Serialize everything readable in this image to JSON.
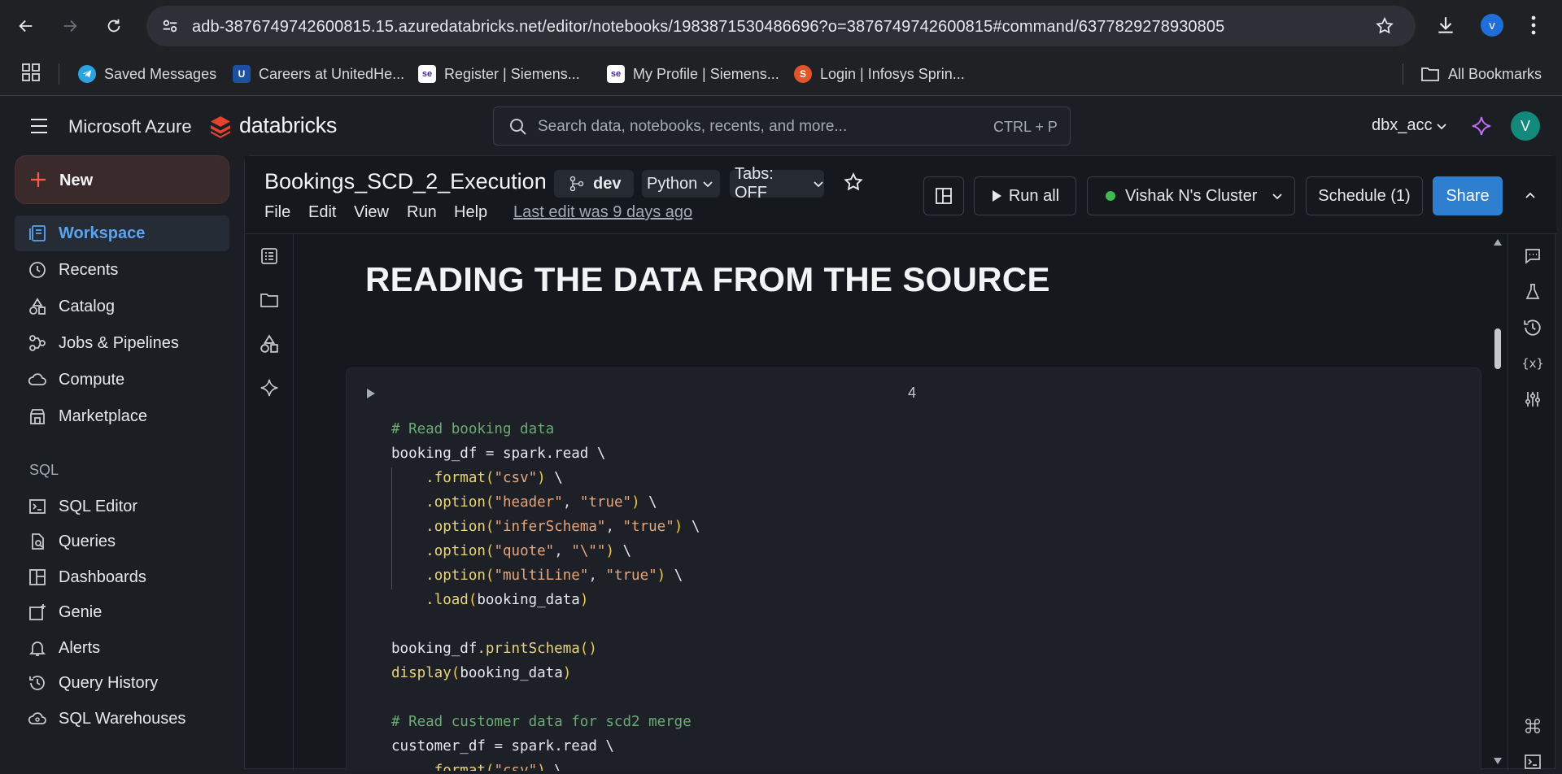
{
  "browser": {
    "url": "adb-3876749742600815.15.azuredatabricks.net/editor/notebooks/1983871530486696?o=3876749742600815#command/6377829278930805",
    "profile_initial": "v",
    "bookmarks": [
      {
        "label": "Saved Messages",
        "icon": "telegram-icon",
        "color": "#2aa3e0"
      },
      {
        "label": "Careers at UnitedHe...",
        "icon": "unitedhealth-icon",
        "color": "#1d4fa3"
      },
      {
        "label": "Register | Siemens...",
        "icon": "siemens-icon",
        "color": "#ffffff"
      },
      {
        "label": "My Profile | Siemens...",
        "icon": "siemens-icon",
        "color": "#ffffff"
      },
      {
        "label": "Login | Infosys Sprin...",
        "icon": "infosys-icon",
        "color": "#e2552a"
      }
    ],
    "all_bookmarks": "All Bookmarks"
  },
  "header": {
    "azure": "Microsoft Azure",
    "brand": "databricks",
    "search_placeholder": "Search data, notebooks, recents, and more...",
    "search_shortcut": "CTRL + P",
    "workspace": "dbx_acc",
    "avatar": "V"
  },
  "sidebar": {
    "new_label": "New",
    "items": [
      {
        "label": "Workspace",
        "icon": "workspace-icon",
        "active": true
      },
      {
        "label": "Recents",
        "icon": "clock-icon"
      },
      {
        "label": "Catalog",
        "icon": "catalog-icon"
      },
      {
        "label": "Jobs & Pipelines",
        "icon": "jobs-icon"
      },
      {
        "label": "Compute",
        "icon": "cloud-icon"
      },
      {
        "label": "Marketplace",
        "icon": "store-icon"
      }
    ],
    "sql_section": "SQL",
    "sql_items": [
      {
        "label": "SQL Editor",
        "icon": "sql-editor-icon"
      },
      {
        "label": "Queries",
        "icon": "queries-icon"
      },
      {
        "label": "Dashboards",
        "icon": "dashboards-icon"
      },
      {
        "label": "Genie",
        "icon": "genie-icon"
      },
      {
        "label": "Alerts",
        "icon": "bell-icon"
      },
      {
        "label": "Query History",
        "icon": "history-icon"
      },
      {
        "label": "SQL Warehouses",
        "icon": "warehouse-icon"
      }
    ]
  },
  "notebook": {
    "title": "Bookings_SCD_2_Execution",
    "branch": "dev",
    "language": "Python",
    "tabs": "Tabs: OFF",
    "menu": [
      "File",
      "Edit",
      "View",
      "Run",
      "Help"
    ],
    "last_edit": "Last edit was 9 days ago",
    "run_all": "Run all",
    "cluster": "Vishak N's Cluster",
    "cluster_status_color": "#3fb950",
    "schedule": "Schedule (1)",
    "share": "Share",
    "heading": "READING THE DATA FROM THE SOURCE",
    "cell_number": "4"
  },
  "code_lines": [
    [
      {
        "t": "# Read booking data",
        "c": "c-com"
      }
    ],
    [
      {
        "t": "booking_df",
        "c": "c-var"
      },
      {
        "t": " = ",
        "c": "c-op"
      },
      {
        "t": "spark.read",
        "c": "c-var"
      },
      {
        "t": " \\",
        "c": "c-bs"
      }
    ],
    [
      {
        "t": "    ",
        "c": "c-var"
      },
      {
        "t": ".format",
        "c": "c-fn"
      },
      {
        "t": "(",
        "c": "c-par"
      },
      {
        "t": "\"csv\"",
        "c": "c-str"
      },
      {
        "t": ")",
        "c": "c-par"
      },
      {
        "t": " \\",
        "c": "c-bs"
      }
    ],
    [
      {
        "t": "    ",
        "c": "c-var"
      },
      {
        "t": ".option",
        "c": "c-fn"
      },
      {
        "t": "(",
        "c": "c-par"
      },
      {
        "t": "\"header\"",
        "c": "c-str"
      },
      {
        "t": ", ",
        "c": "c-op"
      },
      {
        "t": "\"true\"",
        "c": "c-str"
      },
      {
        "t": ")",
        "c": "c-par"
      },
      {
        "t": " \\",
        "c": "c-bs"
      }
    ],
    [
      {
        "t": "    ",
        "c": "c-var"
      },
      {
        "t": ".option",
        "c": "c-fn"
      },
      {
        "t": "(",
        "c": "c-par"
      },
      {
        "t": "\"inferSchema\"",
        "c": "c-str"
      },
      {
        "t": ", ",
        "c": "c-op"
      },
      {
        "t": "\"true\"",
        "c": "c-str"
      },
      {
        "t": ")",
        "c": "c-par"
      },
      {
        "t": " \\",
        "c": "c-bs"
      }
    ],
    [
      {
        "t": "    ",
        "c": "c-var"
      },
      {
        "t": ".option",
        "c": "c-fn"
      },
      {
        "t": "(",
        "c": "c-par"
      },
      {
        "t": "\"quote\"",
        "c": "c-str"
      },
      {
        "t": ", ",
        "c": "c-op"
      },
      {
        "t": "\"\\\"\"",
        "c": "c-str"
      },
      {
        "t": ")",
        "c": "c-par"
      },
      {
        "t": " \\",
        "c": "c-bs"
      }
    ],
    [
      {
        "t": "    ",
        "c": "c-var"
      },
      {
        "t": ".option",
        "c": "c-fn"
      },
      {
        "t": "(",
        "c": "c-par"
      },
      {
        "t": "\"multiLine\"",
        "c": "c-str"
      },
      {
        "t": ", ",
        "c": "c-op"
      },
      {
        "t": "\"true\"",
        "c": "c-str"
      },
      {
        "t": ")",
        "c": "c-par"
      },
      {
        "t": " \\",
        "c": "c-bs"
      }
    ],
    [
      {
        "t": "    ",
        "c": "c-var"
      },
      {
        "t": ".load",
        "c": "c-fn"
      },
      {
        "t": "(",
        "c": "c-par"
      },
      {
        "t": "booking_data",
        "c": "c-var"
      },
      {
        "t": ")",
        "c": "c-par"
      }
    ],
    [],
    [
      {
        "t": "booking_df",
        "c": "c-var"
      },
      {
        "t": ".printSchema",
        "c": "c-fn"
      },
      {
        "t": "()",
        "c": "c-par"
      }
    ],
    [
      {
        "t": "display",
        "c": "c-fn"
      },
      {
        "t": "(",
        "c": "c-par"
      },
      {
        "t": "booking_data",
        "c": "c-var"
      },
      {
        "t": ")",
        "c": "c-par"
      }
    ],
    [],
    [
      {
        "t": "# Read customer data for scd2 merge",
        "c": "c-com"
      }
    ],
    [
      {
        "t": "customer_df",
        "c": "c-var"
      },
      {
        "t": " = ",
        "c": "c-op"
      },
      {
        "t": "spark.read",
        "c": "c-var"
      },
      {
        "t": " \\",
        "c": "c-bs"
      }
    ],
    [
      {
        "t": "    ",
        "c": "c-var"
      },
      {
        "t": ".format",
        "c": "c-fn"
      },
      {
        "t": "(",
        "c": "c-par"
      },
      {
        "t": "\"csv\"",
        "c": "c-str"
      },
      {
        "t": ")",
        "c": "c-par"
      },
      {
        "t": " \\",
        "c": "c-bs"
      }
    ]
  ]
}
